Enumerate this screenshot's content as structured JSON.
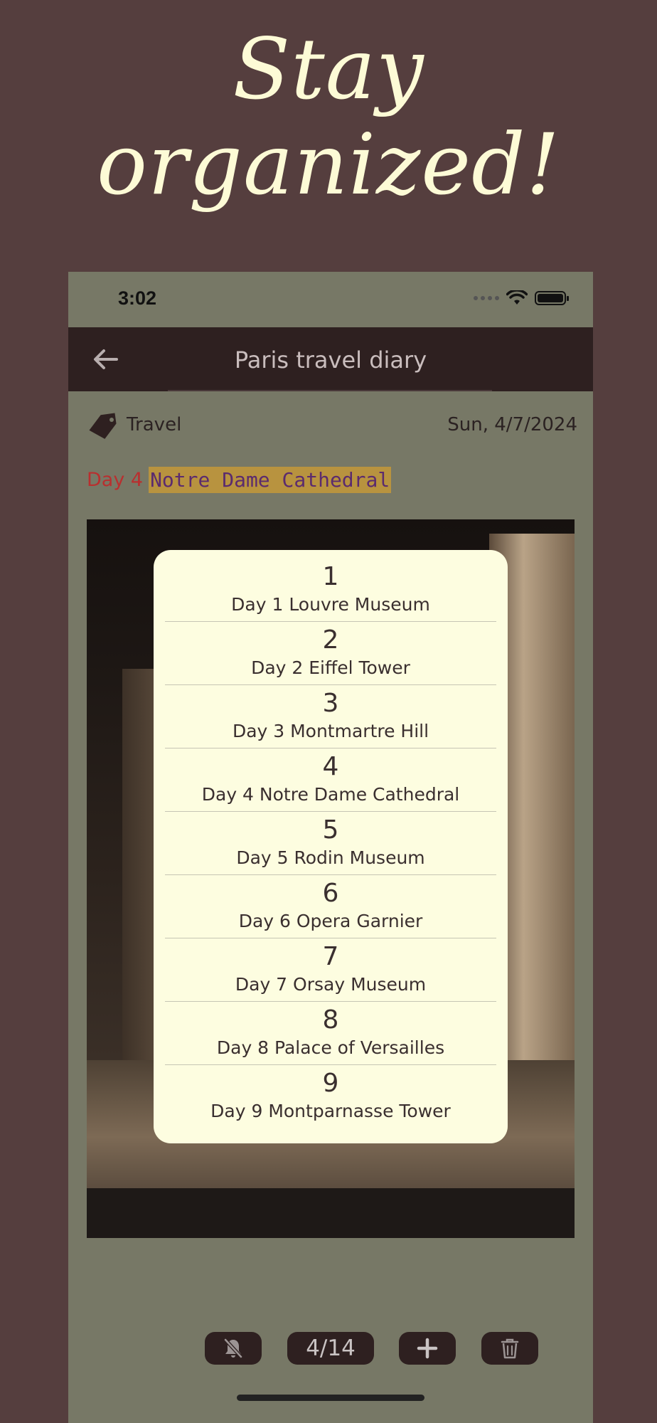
{
  "headline": {
    "line1": "Stay",
    "line2": "organized!"
  },
  "status_bar": {
    "time": "3:02",
    "battery_level": 1.0
  },
  "app_bar": {
    "title": "Paris travel diary",
    "back_icon": "arrow-left-icon"
  },
  "entry": {
    "tag_icon": "tag-icon",
    "tag": "Travel",
    "date": "Sun, 4/7/2024",
    "day_prefix": "Day 4",
    "title": "Notre Dame Cathedral"
  },
  "nav_popup": {
    "items": [
      {
        "number": "1",
        "label": "Day 1 Louvre Museum"
      },
      {
        "number": "2",
        "label": "Day 2 Eiffel Tower"
      },
      {
        "number": "3",
        "label": "Day 3 Montmartre Hill"
      },
      {
        "number": "4",
        "label": "Day 4 Notre Dame Cathedral"
      },
      {
        "number": "5",
        "label": "Day 5 Rodin Museum"
      },
      {
        "number": "6",
        "label": "Day 6 Opera Garnier"
      },
      {
        "number": "7",
        "label": "Day 7 Orsay Museum"
      },
      {
        "number": "8",
        "label": "Day 8 Palace of Versailles"
      },
      {
        "number": "9",
        "label": "Day 9 Montparnasse Tower"
      }
    ]
  },
  "toolbar": {
    "mute_icon": "bell-off-icon",
    "page_indicator": "4/14",
    "add_icon": "plus-icon",
    "delete_icon": "trash-icon"
  },
  "colors": {
    "background": "#553e3e",
    "phone_background": "#777866",
    "app_bar": "#2e2020",
    "popup": "#fdfde0",
    "highlight": "#b8933f",
    "day_prefix": "#b92f2f",
    "headline": "#fdfbd6"
  }
}
